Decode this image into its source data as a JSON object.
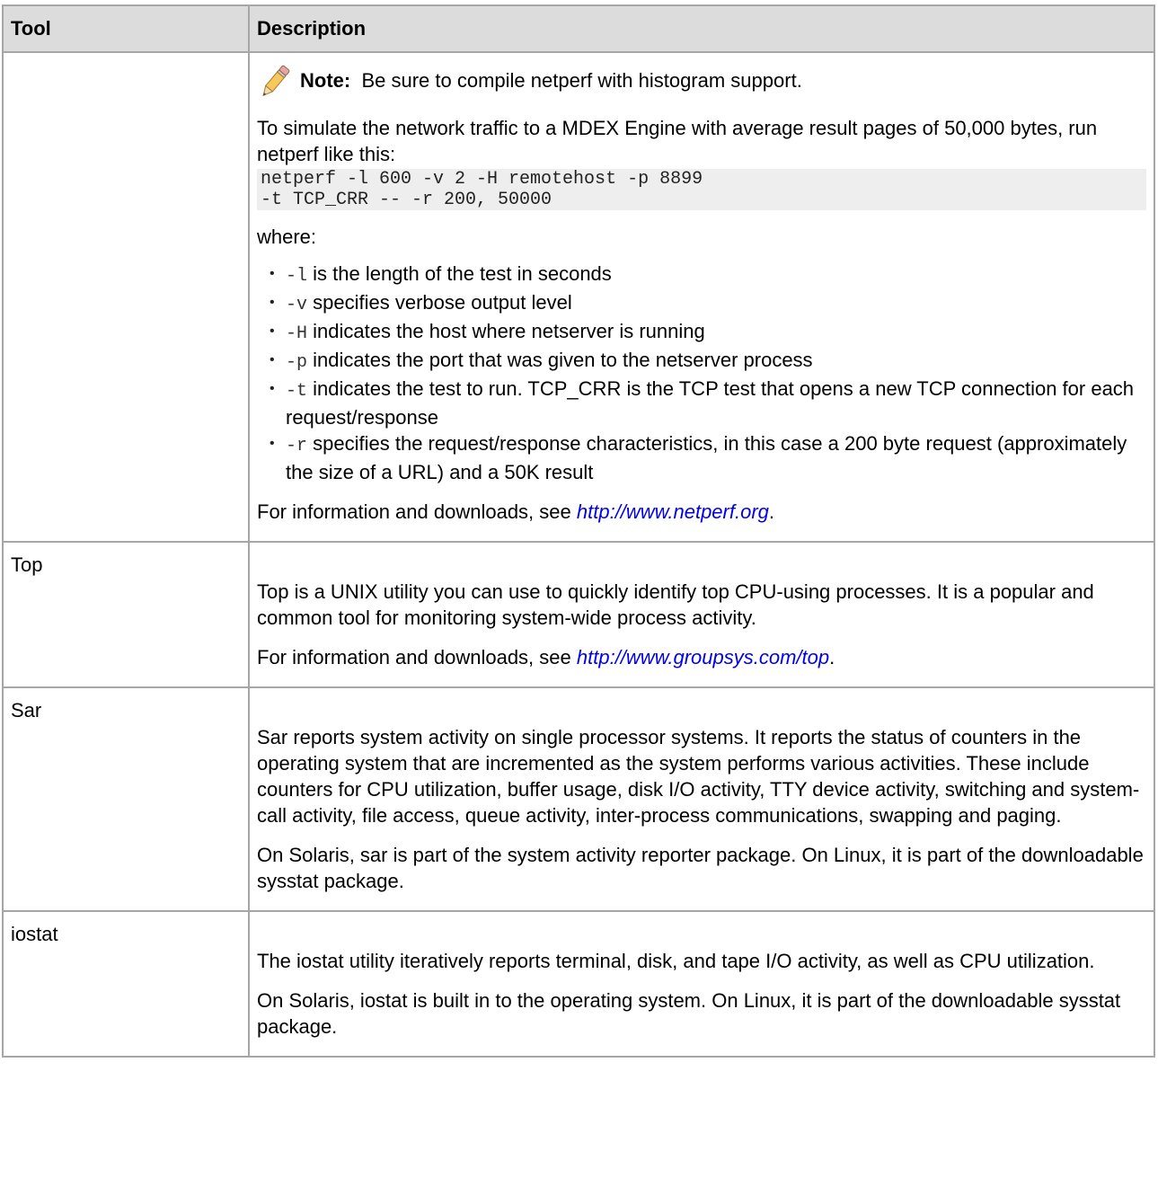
{
  "table": {
    "headers": [
      "Tool",
      "Description"
    ]
  },
  "netperf": {
    "tool": "",
    "note_label": "Note:",
    "note_text": "Be sure to compile netperf with histogram support.",
    "intro": "To simulate the network traffic to a MDEX Engine with average result pages of 50,000 bytes, run netperf like this:",
    "code": "netperf -l 600 -v 2 -H remotehost -p 8899\n-t TCP_CRR -- -r 200, 50000",
    "where": "where:",
    "options": [
      {
        "flag": "-l",
        "text": "is the length of the test in seconds"
      },
      {
        "flag": "-v",
        "text": "specifies verbose output level"
      },
      {
        "flag": "-H",
        "text": "indicates the host where netserver is running"
      },
      {
        "flag": "-p",
        "text": "indicates the port that was given to the netserver process"
      },
      {
        "flag": "-t",
        "text": "indicates the test to run. TCP_CRR is the TCP test that opens a new TCP connection for each request/response"
      },
      {
        "flag": "-r",
        "text": "specifies the request/response characteristics, in this case a 200 byte request (approximately the size of a URL) and a 50K result"
      }
    ],
    "info_prefix": "For information and downloads, see",
    "link": "http://www.netperf.org",
    "info_suffix": "."
  },
  "top": {
    "tool": "Top",
    "desc": "Top is a UNIX utility you can use to quickly identify top CPU-using processes. It is a popular and common tool for monitoring system-wide process activity.",
    "info_prefix": "For information and downloads, see",
    "link": "http://www.groupsys.com/top",
    "info_suffix": "."
  },
  "sar": {
    "tool": "Sar",
    "desc": "Sar reports system activity on single processor systems. It reports the status of counters in the operating system that are incremented as the system performs various activities. These include counters for CPU utilization, buffer usage, disk I/O activity, TTY device activity, switching and system-call activity, file access, queue activity, inter-process communications, swapping and paging.",
    "desc2": "On Solaris, sar is part of the system activity reporter package. On Linux, it is part of the downloadable sysstat package."
  },
  "iostat": {
    "tool": "iostat",
    "desc": "The iostat utility iteratively reports terminal, disk, and tape I/O activity, as well as CPU utilization.",
    "desc2": "On Solaris, iostat is built in to the operating system. On Linux, it is part of the downloadable sysstat package."
  },
  "icons": {
    "note": "pencil-icon"
  }
}
